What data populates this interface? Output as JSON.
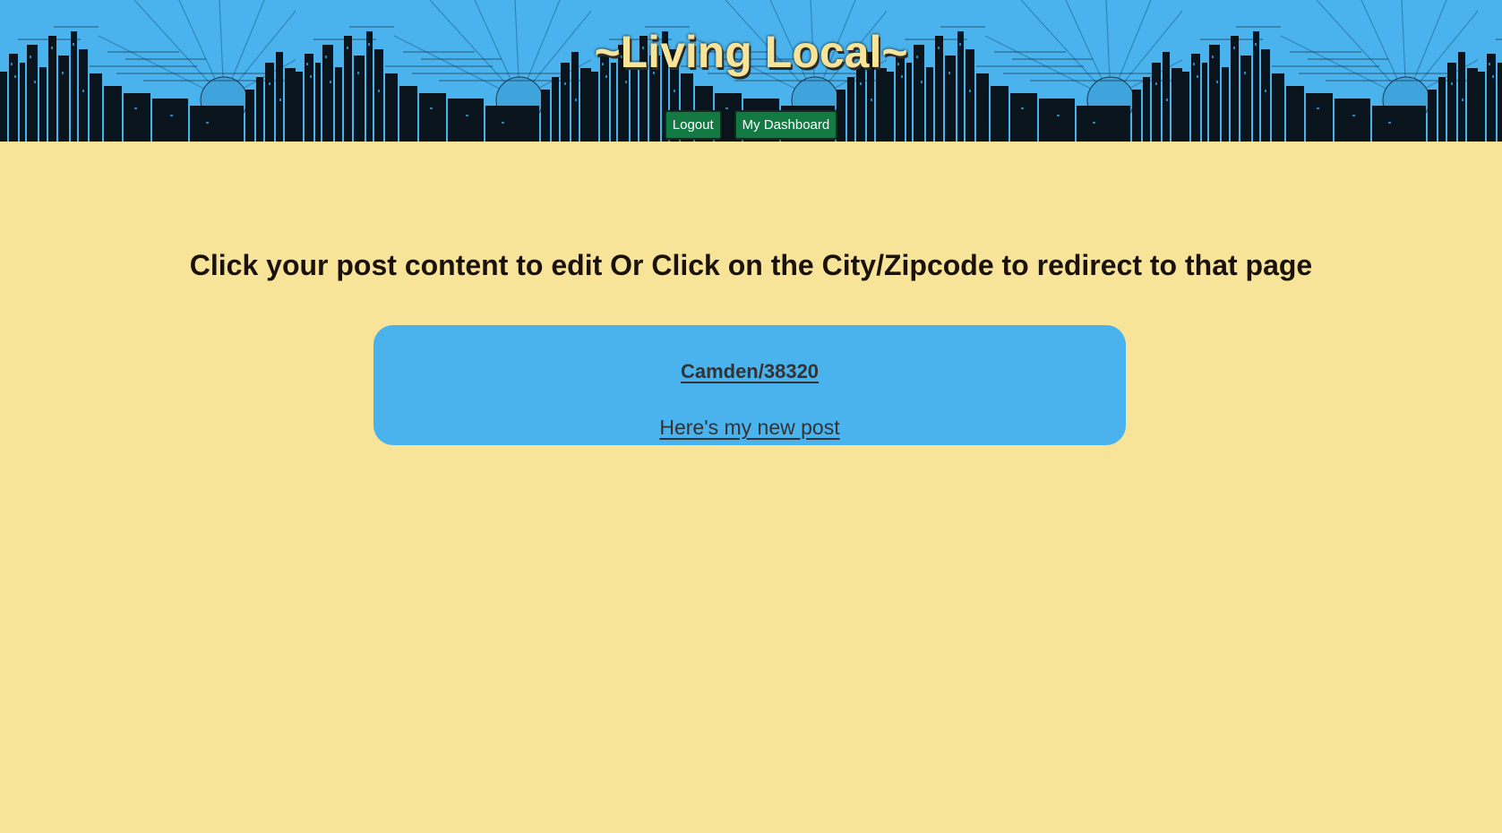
{
  "header": {
    "title": "~Living Local~",
    "nav": {
      "logout_label": "Logout",
      "dashboard_label": "My Dashboard"
    },
    "colors": {
      "sky": "#4ab2ec",
      "title_text": "#f8e499",
      "button_bg": "#137a44"
    }
  },
  "main": {
    "instructions": "Click your post content to edit Or Click on the City/Zipcode to redirect to that page",
    "posts": [
      {
        "location": "Camden/38320",
        "content": "Here's my new post"
      }
    ],
    "colors": {
      "page_bg": "#f8e499",
      "card_bg": "#4ab2ec"
    }
  }
}
